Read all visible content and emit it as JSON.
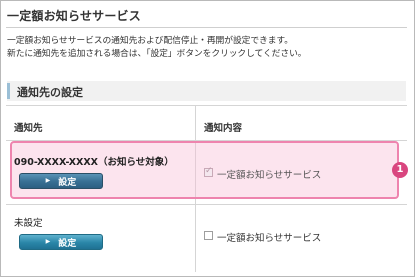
{
  "page": {
    "title": "一定額お知らせサービス",
    "description_line1": "一定額お知らせサービスの通知先および配信停止・再開が設定できます。",
    "description_line2": "新たに通知先を追加される場合は、「設定」ボタンをクリックしてください。"
  },
  "section": {
    "title": "通知先の設定"
  },
  "table": {
    "col_recipient": "通知先",
    "col_content": "通知内容",
    "rows": [
      {
        "recipient": "090-XXXX-XXXX（お知らせ対象）",
        "button_label": "設定",
        "content_label": "一定額お知らせサービス",
        "checked": true
      },
      {
        "recipient": "未設定",
        "button_label": "設定",
        "content_label": "一定額お知らせサービス",
        "checked": false
      }
    ]
  },
  "callout": {
    "number": "1"
  },
  "colors": {
    "highlight_border": "#ee84ae",
    "highlight_fill": "#f7bed6",
    "badge": "#d9467f",
    "button": "#2a86a8",
    "section_bar": "#9bbfd6"
  },
  "icons": [
    "arrow-right-icon",
    "checkbox-icon"
  ]
}
